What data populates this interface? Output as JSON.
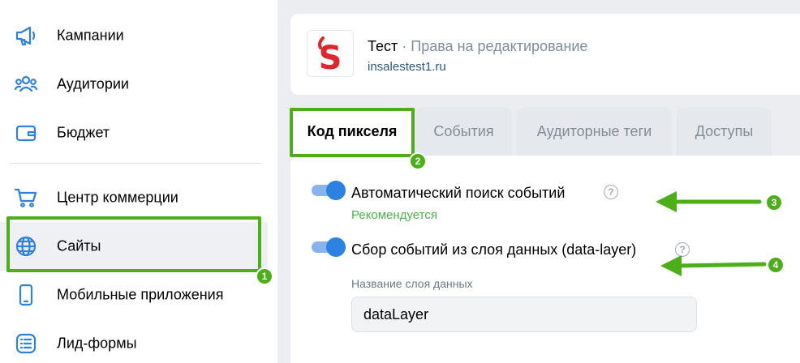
{
  "sidebar": {
    "items": [
      {
        "label": "Кампании",
        "icon": "megaphone-icon"
      },
      {
        "label": "Аудитории",
        "icon": "users-icon"
      },
      {
        "label": "Бюджет",
        "icon": "wallet-icon"
      },
      {
        "label": "Центр коммерции",
        "icon": "cart-icon"
      },
      {
        "label": "Сайты",
        "icon": "globe-icon",
        "active": true
      },
      {
        "label": "Мобильные приложения",
        "icon": "smartphone-icon"
      },
      {
        "label": "Лид-формы",
        "icon": "list-icon"
      }
    ]
  },
  "site": {
    "name": "Тест",
    "separator": " · ",
    "role": "Права на редактирование",
    "url": "insalestest1.ru",
    "logo_letter": "S",
    "logo_color": "#e0262d"
  },
  "tabs": [
    {
      "label": "Код пикселя",
      "active": true
    },
    {
      "label": "События"
    },
    {
      "label": "Аудиторные теги"
    },
    {
      "label": "Доступы"
    }
  ],
  "settings": {
    "auto_search": {
      "label": "Автоматический поиск событий",
      "enabled": true,
      "hint": "Рекомендуется"
    },
    "data_layer": {
      "label": "Сбор событий из слоя данных (data-layer)",
      "enabled": true,
      "field_label": "Название слоя данных",
      "field_value": "dataLayer"
    },
    "help_glyph": "?"
  },
  "annotations": {
    "badges": [
      "1",
      "2",
      "3",
      "4"
    ],
    "color": "#4caf1a"
  },
  "colors": {
    "accent": "#2d81e0",
    "success": "#4bb34b",
    "link": "#2a5885"
  }
}
